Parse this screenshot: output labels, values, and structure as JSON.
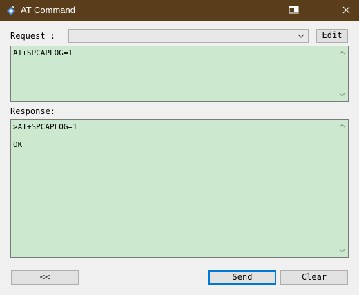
{
  "window": {
    "title": "AT Command",
    "title_bar_color": "#5a3d1b"
  },
  "request": {
    "label": "Request :",
    "dropdown_value": "",
    "edit_label": "Edit",
    "text": "AT+SPCAPLOG=1"
  },
  "response": {
    "label": "Response:",
    "line1": ">AT+SPCAPLOG=1",
    "line2": "OK"
  },
  "buttons": {
    "back_label": "<<",
    "send_label": "Send",
    "clear_label": "Clear"
  },
  "colors": {
    "text_area_bg": "#cce8cf",
    "dialog_bg": "#f0f0f0",
    "default_button_border": "#0078d7"
  },
  "icons": {
    "app": "at-command-app-icon",
    "restore": "restore-window-icon",
    "close": "close-icon",
    "dropdown": "chevron-down-icon"
  }
}
